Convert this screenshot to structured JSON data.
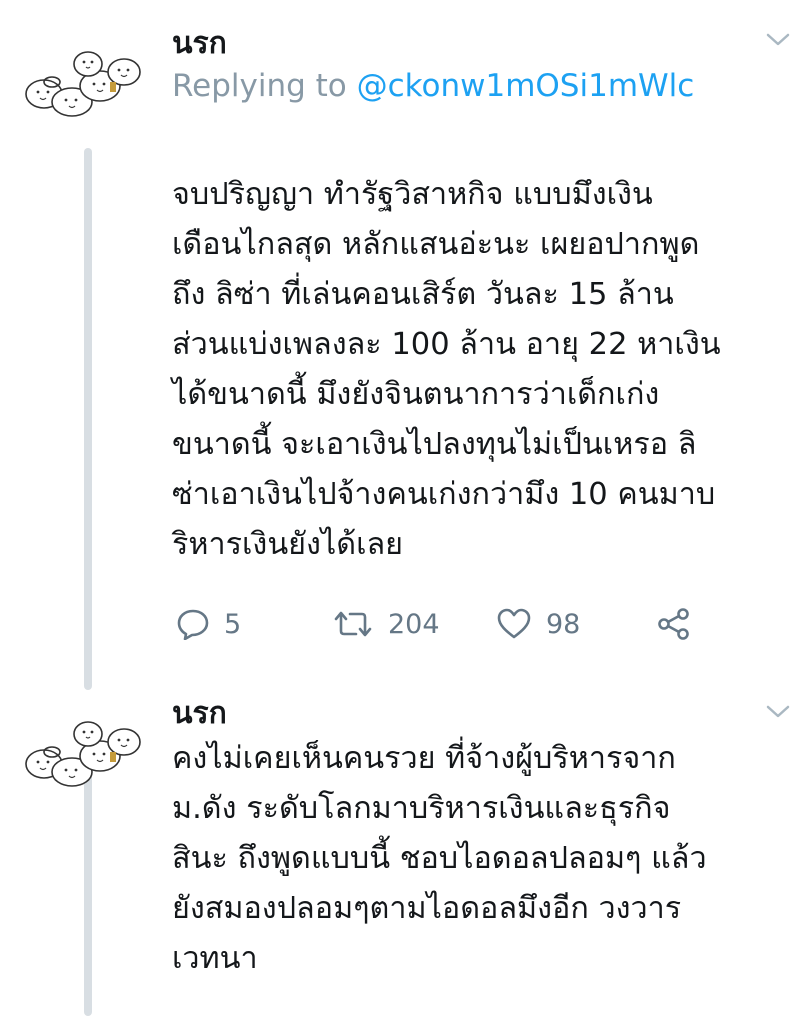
{
  "thread": {
    "main_tweet": {
      "author": "นรก",
      "replying_to_prefix": "Replying to ",
      "replying_to_handle": "@ckonw1mOSi1mWlc",
      "text": "จบปริญญา ทำรัฐวิสาหกิจ แบบมึงเงิน\nเดือนไกลสุด หลักแสนอ่ะนะ เผยอปากพูด\nถึง ลิซ่า ที่เล่นคอนเสิร์ต วันละ 15 ล้าน\nส่วนแบ่งเพลงละ 100 ล้าน อายุ 22 หาเงิน\nได้ขนาดนี้ มึงยังจินตนาการว่าเด็กเก่ง\nขนาดนี้ จะเอาเงินไปลงทุนไม่เป็นเหรอ ลิ\nซ่าเอาเงินไปจ้างคนเก่งกว่ามึง 10 คนมาบ\nริหารเงินยังได้เลย",
      "actions": {
        "reply_count": "5",
        "retweet_count": "204",
        "like_count": "98"
      },
      "icons": {
        "reply": "reply-icon",
        "retweet": "retweet-icon",
        "like": "heart-icon",
        "share": "share-icon",
        "menu": "chevron-down-icon"
      }
    },
    "reply_tweet": {
      "author": "นรก",
      "text": "คงไม่เคยเห็นคนรวย ที่จ้างผู้บริหารจาก\nม.ดัง ระดับโลกมาบริหารเงินและธุรกิจ\nสินะ ถึงพูดแบบนี้ ชอบไอดอลปลอมๆ แล้ว\nยังสมองปลอมๆตามไอดอลมึงอีก วงวาร\nเวทนา"
    }
  },
  "colors": {
    "text": "#14171a",
    "muted": "#8899a6",
    "link": "#1da1f2",
    "action": "#657786",
    "thread_line": "#d8dee3"
  }
}
